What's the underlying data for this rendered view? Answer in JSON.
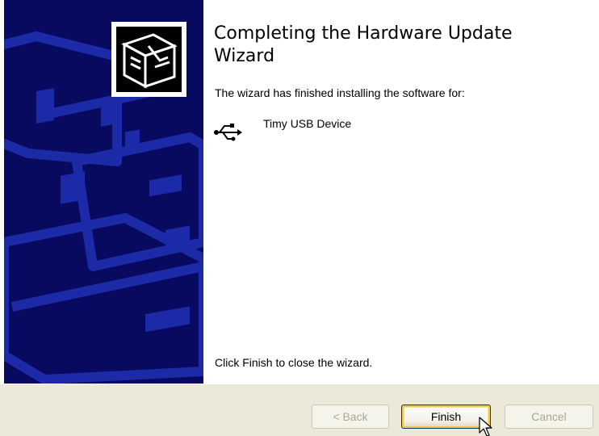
{
  "wizard": {
    "title": "Completing the Hardware Update Wizard",
    "finished_message": "The wizard has finished installing the software for:",
    "device_name": "Timy USB Device",
    "close_message": "Click Finish to close the wizard."
  },
  "buttons": {
    "back_label": "< Back",
    "finish_label": "Finish",
    "cancel_label": "Cancel"
  },
  "icons": {
    "banner_icon": "hardware-box-icon",
    "device_icon": "usb-icon",
    "pointer": "mouse-cursor-icon"
  },
  "colors": {
    "banner_background": "#070a5e",
    "banner_shapes": "#1c2aa8",
    "footer_background": "#ece9d8",
    "default_button_highlight": "#f0c656"
  }
}
